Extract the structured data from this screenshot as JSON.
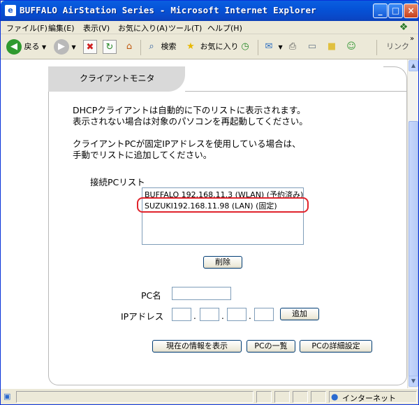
{
  "window": {
    "title": "BUFFALO AirStation Series - Microsoft Internet Explorer",
    "minimize": "_",
    "maximize": "□",
    "close": "×"
  },
  "menu": [
    "ファイル(F)",
    "編集(E)",
    "表示(V)",
    "お気に入り(A)",
    "ツール(T)",
    "ヘルプ(H)"
  ],
  "toolbar": {
    "back_label": "戻る",
    "search_label": "検索",
    "favorites_label": "お気に入り",
    "links_label": "リンク"
  },
  "page": {
    "tab_title": "クライアントモニタ",
    "para1_line1": "DHCPクライアントは自動的に下のリストに表示されます。",
    "para1_line2": "表示されない場合は対象のパソコンを再起動してください。",
    "para2_line1": "クライアントPCが固定IPアドレスを使用している場合は、",
    "para2_line2": "手動でリストに追加してください。",
    "list_label": "接続PCリスト",
    "list_items": [
      "BUFFALO 192.168.11.3 (WLAN) (予約済み)",
      "SUZUKI192.168.11.98 (LAN) (固定)"
    ],
    "delete_button": "削除",
    "pc_name_label": "PC名",
    "ip_label": "IPアドレス",
    "ip_dot": ".",
    "add_button": "追加",
    "show_info_button": "現在の情報を表示",
    "pc_list_button": "PCの一覧",
    "pc_detail_button": "PCの詳細設定"
  },
  "status": {
    "zone": "インターネット"
  }
}
